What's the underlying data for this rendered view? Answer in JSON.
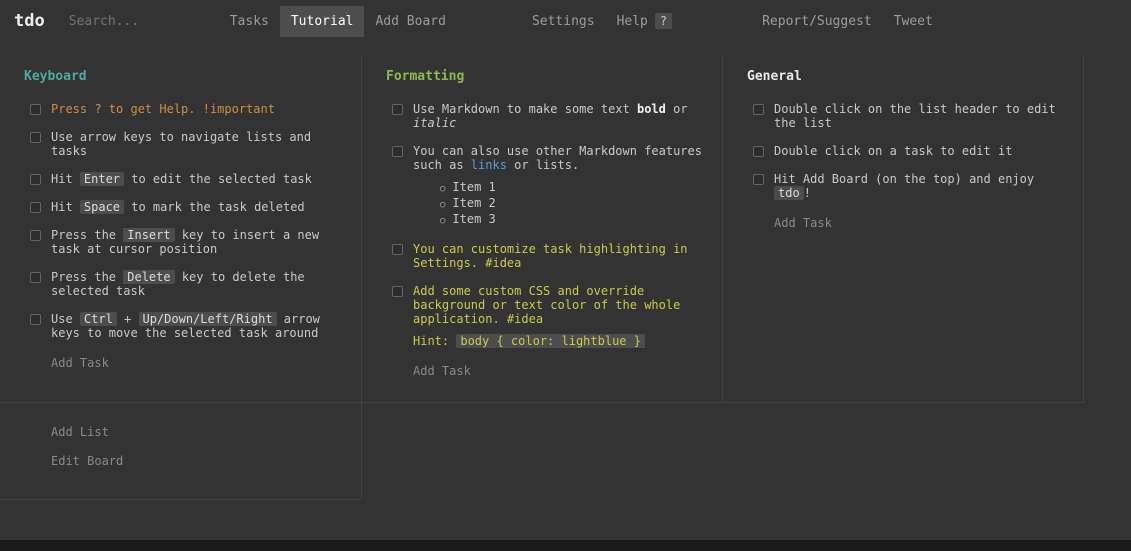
{
  "navbar": {
    "logo": "tdo",
    "search": {
      "placeholder": "Search...",
      "value": ""
    },
    "items": [
      {
        "label": "Tasks",
        "active": false
      },
      {
        "label": "Tutorial",
        "active": true
      },
      {
        "label": "Add Board",
        "active": false
      },
      {
        "label": "Settings",
        "active": false
      },
      {
        "label": "Help",
        "active": false,
        "badge": "?"
      },
      {
        "label": "Report/Suggest",
        "active": false
      },
      {
        "label": "Tweet",
        "active": false
      }
    ]
  },
  "colors": {
    "accent-orange": "#d28d3f",
    "accent-yellow": "#cbcb49",
    "link-blue": "#56a0d3"
  },
  "board": {
    "lists": [
      {
        "title": "Keyboard",
        "title_color": "#4fa99f",
        "add_task_label": "Add Task",
        "tasks": [
          {
            "checked": false,
            "color": "orange",
            "segments": [
              {
                "t": "Press ? to get Help. !important"
              }
            ]
          },
          {
            "checked": false,
            "segments": [
              {
                "t": "Use arrow keys to navigate lists and tasks"
              }
            ]
          },
          {
            "checked": false,
            "segments": [
              {
                "t": "Hit "
              },
              {
                "t": "Enter",
                "s": "kbd"
              },
              {
                "t": " to edit the selected task"
              }
            ]
          },
          {
            "checked": false,
            "segments": [
              {
                "t": "Hit "
              },
              {
                "t": "Space",
                "s": "kbd"
              },
              {
                "t": " to mark the task deleted"
              }
            ]
          },
          {
            "checked": false,
            "segments": [
              {
                "t": "Press the "
              },
              {
                "t": "Insert",
                "s": "kbd"
              },
              {
                "t": " key to insert a new task at cursor position"
              }
            ]
          },
          {
            "checked": false,
            "segments": [
              {
                "t": "Press the "
              },
              {
                "t": "Delete",
                "s": "kbd"
              },
              {
                "t": " key to delete the selected task"
              }
            ]
          },
          {
            "checked": false,
            "segments": [
              {
                "t": "Use "
              },
              {
                "t": "Ctrl",
                "s": "kbd"
              },
              {
                "t": " + "
              },
              {
                "t": "Up/Down/Left/Right",
                "s": "kbd"
              },
              {
                "t": " arrow keys to move the selected task around"
              }
            ]
          }
        ]
      },
      {
        "title": "Formatting",
        "title_color": "#8cba50",
        "add_task_label": "Add Task",
        "tasks": [
          {
            "checked": false,
            "segments": [
              {
                "t": "Use Markdown to make some text "
              },
              {
                "t": "bold",
                "s": "bold"
              },
              {
                "t": " or "
              },
              {
                "t": "italic",
                "s": "italic"
              }
            ]
          },
          {
            "checked": false,
            "segments": [
              {
                "t": "You can also use other Markdown features such as "
              },
              {
                "t": "links",
                "s": "link"
              },
              {
                "t": " or lists."
              }
            ],
            "list": [
              "Item 1",
              "Item 2",
              "Item 3"
            ]
          },
          {
            "checked": false,
            "color": "yellow",
            "segments": [
              {
                "t": "You can customize task highlighting in Settings. #idea"
              }
            ]
          },
          {
            "checked": false,
            "color": "yellow",
            "segments": [
              {
                "t": "Add some custom CSS and override background or text color of the whole application. #idea"
              }
            ],
            "extra": [
              {
                "t": "Hint: "
              },
              {
                "t": "body { color: lightblue }",
                "s": "kbd"
              }
            ]
          }
        ]
      },
      {
        "title": "General",
        "title_color": "#e9e9e9",
        "add_task_label": "Add Task",
        "tasks": [
          {
            "checked": false,
            "segments": [
              {
                "t": "Double click on the list header to edit the list"
              }
            ]
          },
          {
            "checked": false,
            "segments": [
              {
                "t": "Double click on a task to edit it"
              }
            ]
          },
          {
            "checked": false,
            "segments": [
              {
                "t": "Hit Add Board (on the top) and enjoy "
              },
              {
                "t": "tdo",
                "s": "kbd"
              },
              {
                "t": "!"
              }
            ]
          }
        ]
      }
    ],
    "actions": {
      "add_list": "Add List",
      "edit_board": "Edit Board"
    }
  }
}
